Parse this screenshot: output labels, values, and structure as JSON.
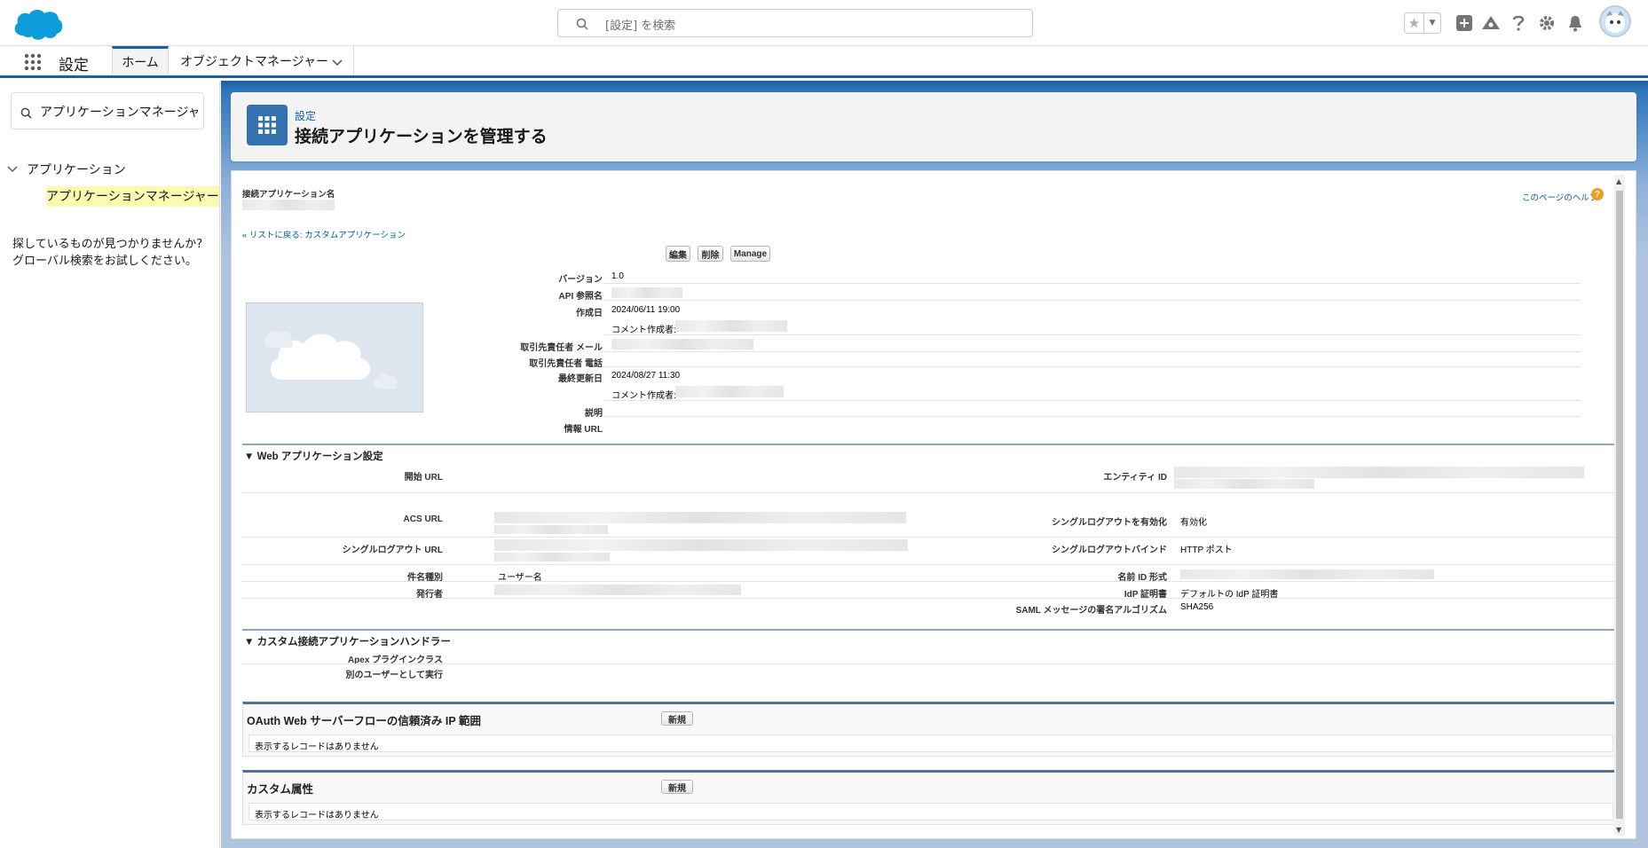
{
  "header": {
    "search_placeholder": "[設定] を検索"
  },
  "nav": {
    "app_name": "設定",
    "tab_home": "ホーム",
    "tab_object_manager": "オブジェクトマネージャー"
  },
  "sidebar": {
    "quickfind_value": "アプリケーションマネージャー",
    "tree_parent": "アプリケーション",
    "tree_child": "アプリケーションマネージャー",
    "not_found_line1": "探しているものが見つかりませんか?",
    "not_found_line2": "グローバル検索をお試しください。"
  },
  "page_header": {
    "breadcrumb": "設定",
    "title": "接続アプリケーションを管理する"
  },
  "detail": {
    "app_name_label": "接続アプリケーション名",
    "help_link": "このページのヘルプ",
    "back_link": "« リストに戻る: カスタムアプリケーション",
    "buttons": {
      "edit": "編集",
      "delete": "削除",
      "manage": "Manage"
    },
    "fields": {
      "version_label": "バージョン",
      "version_value": "1.0",
      "api_name_label": "API 参照名",
      "created_label": "作成日",
      "created_value": "2024/06/11 19:00",
      "comment_by_label_1": "コメント作成者:",
      "contact_email_label": "取引先責任者 メール",
      "contact_phone_label": "取引先責任者 電話",
      "modified_label": "最終更新日",
      "modified_value": "2024/08/27 11:30",
      "comment_by_label_2": "コメント作成者:",
      "description_label": "説明",
      "info_url_label": "情報 URL"
    }
  },
  "web_app": {
    "section_title": "Web アプリケーション設定",
    "start_url_label": "開始 URL",
    "entity_id_label": "エンティティ ID",
    "acs_url_label": "ACS URL",
    "slo_enabled_label": "シングルログアウトを有効化",
    "slo_enabled_value": "有効化",
    "slo_url_label": "シングルログアウト URL",
    "slo_binding_label": "シングルログアウトバインド",
    "slo_binding_value": "HTTP ポスト",
    "subject_type_label": "件名種別",
    "subject_type_value": "ユーザー名",
    "name_id_label": "名前 ID 形式",
    "issuer_label": "発行者",
    "idp_cert_label": "IdP 証明書",
    "idp_cert_value": "デフォルトの IdP 証明書",
    "saml_sig_label": "SAML メッセージの署名アルゴリズム",
    "saml_sig_value": "SHA256"
  },
  "handler": {
    "section_title": "カスタム接続アプリケーションハンドラー",
    "apex_label": "Apex プラグインクラス",
    "run_as_label": "別のユーザーとして実行"
  },
  "related_lists": [
    {
      "title": "OAuth Web サーバーフローの信頼済み IP 範囲",
      "button": "新規",
      "empty": "表示するレコードはありません"
    },
    {
      "title": "カスタム属性",
      "button": "新規",
      "empty": "表示するレコードはありません"
    }
  ],
  "colors": {
    "brand_blue": "#1b5fa5",
    "link": "#015ba7",
    "highlight": "#fafab1"
  }
}
